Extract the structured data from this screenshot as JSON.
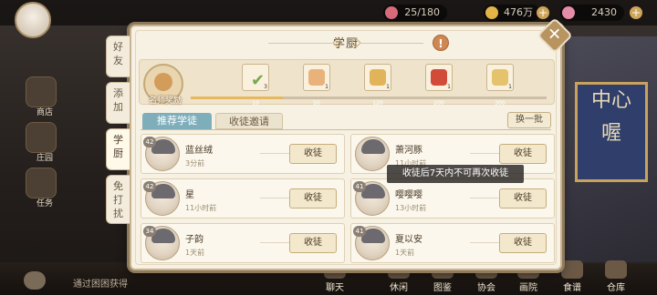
{
  "topbar": {
    "resources": [
      {
        "icon": "heart-icon",
        "value": "25/180",
        "color": "#d86a7a"
      },
      {
        "icon": "coin-icon",
        "value": "476万",
        "color": "#e3b547"
      },
      {
        "icon": "gem-icon",
        "value": "2430",
        "color": "#e58da7"
      }
    ]
  },
  "left_menu": [
    {
      "label": "商店",
      "icon": "shop-icon"
    },
    {
      "label": "庄园",
      "icon": "manor-icon"
    },
    {
      "label": "任务",
      "icon": "task-icon"
    }
  ],
  "dialog": {
    "title": "学厨",
    "help": "!",
    "close": "✕",
    "side_tabs": [
      {
        "label": "好友",
        "active": false
      },
      {
        "label": "添加",
        "active": false
      },
      {
        "label": "学厨",
        "active": true
      },
      {
        "label": "免打扰",
        "active": false
      }
    ],
    "master_label": "名师奖励",
    "progress_fraction": 0.26,
    "rewards": [
      {
        "milestone": "10",
        "count": "3",
        "claimed": true,
        "color": "#7aa84c",
        "icon": "check-icon"
      },
      {
        "milestone": "50",
        "count": "1",
        "claimed": false,
        "color": "#e9b27a",
        "icon": "cake-icon"
      },
      {
        "milestone": "120",
        "count": "1",
        "claimed": false,
        "color": "#e2b45a",
        "icon": "ring-icon"
      },
      {
        "milestone": "200",
        "count": "1",
        "claimed": false,
        "color": "#d24a38",
        "icon": "gift-box-icon"
      },
      {
        "milestone": "300",
        "count": "1",
        "claimed": false,
        "color": "#e4c36c",
        "icon": "ingredient-icon"
      }
    ],
    "tabs": {
      "recommend": "推荐学徒",
      "invite": "收徒邀请"
    },
    "refresh": "换一批",
    "toast": "收徒后7天内不可再次收徒",
    "recruit_label": "收徒",
    "apprentices": [
      {
        "name": "蓝丝绒",
        "level": "42",
        "time": "3分前",
        "button": "收徒"
      },
      {
        "name": "萧河豚",
        "level": "",
        "time": "11小时前",
        "button": "收徒"
      },
      {
        "name": "星",
        "level": "42",
        "time": "11小时前",
        "button": "收徒"
      },
      {
        "name": "嘤嘤嘤",
        "level": "41",
        "time": "13小时前",
        "button": "收徒"
      },
      {
        "name": "子韵",
        "level": "34",
        "time": "1天前",
        "button": "收徒"
      },
      {
        "name": "夏以安",
        "level": "41",
        "time": "1天前",
        "button": "收徒"
      }
    ]
  },
  "bottom": {
    "notice": "通过困困获得",
    "nav": [
      {
        "label": "聊天",
        "icon": "chat-icon"
      },
      {
        "label": "休闲",
        "icon": "leisure-icon"
      },
      {
        "label": "图鉴",
        "icon": "album-icon"
      },
      {
        "label": "协会",
        "icon": "guild-icon"
      },
      {
        "label": "画院",
        "icon": "gallery-icon"
      },
      {
        "label": "食谱",
        "icon": "recipe-icon"
      },
      {
        "label": "仓库",
        "icon": "warehouse-icon"
      }
    ]
  },
  "scene": {
    "sign_text": "中心\n喔"
  }
}
